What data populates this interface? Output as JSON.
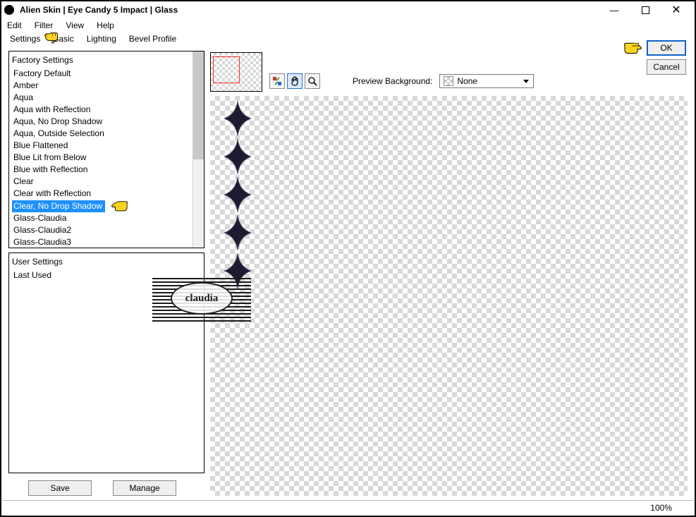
{
  "window": {
    "title": "Alien Skin | Eye Candy 5 Impact | Glass"
  },
  "menubar": {
    "edit": "Edit",
    "filter": "Filter",
    "view": "View",
    "help": "Help"
  },
  "tabs": {
    "settings": "Settings",
    "basic": "Basic",
    "lighting": "Lighting",
    "bevel": "Bevel Profile"
  },
  "factory": {
    "heading": "Factory Settings",
    "items": [
      "Factory Default",
      "Amber",
      "Aqua",
      "Aqua with Reflection",
      "Aqua, No Drop Shadow",
      "Aqua, Outside Selection",
      "Blue Flattened",
      "Blue Lit from Below",
      "Blue with Reflection",
      "Clear",
      "Clear with Reflection",
      "Clear, No Drop Shadow",
      "Glass-Claudia",
      "Glass-Claudia2",
      "Glass-Claudia3"
    ],
    "selected": "Clear, No Drop Shadow"
  },
  "user": {
    "heading": "User Settings",
    "items": [
      "Last Used"
    ]
  },
  "buttons": {
    "save": "Save",
    "manage": "Manage",
    "ok": "OK",
    "cancel": "Cancel"
  },
  "preview": {
    "label": "Preview Background:",
    "value": "None"
  },
  "status": {
    "zoom": "100%"
  },
  "watermark": {
    "text": "claudia"
  }
}
